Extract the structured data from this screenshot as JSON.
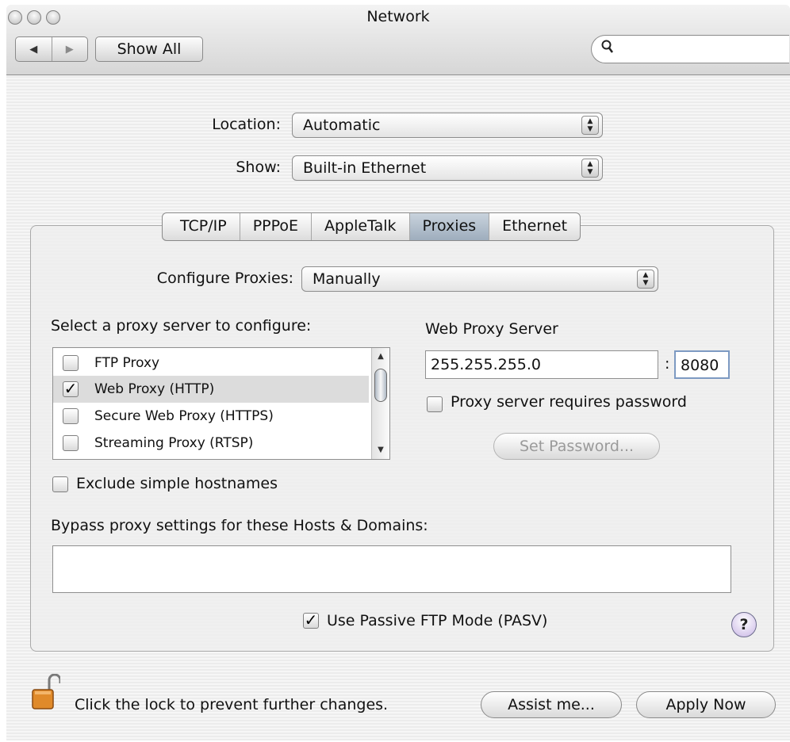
{
  "window": {
    "title": "Network"
  },
  "toolbar": {
    "back_glyph": "◀",
    "forward_glyph": "▶",
    "show_all_label": "Show All",
    "search_icon": "🔍"
  },
  "location": {
    "label": "Location:",
    "value": "Automatic"
  },
  "show": {
    "label": "Show:",
    "value": "Built-in Ethernet"
  },
  "tabs": [
    {
      "label": "TCP/IP"
    },
    {
      "label": "PPPoE"
    },
    {
      "label": "AppleTalk"
    },
    {
      "label": "Proxies",
      "active": true
    },
    {
      "label": "Ethernet"
    }
  ],
  "configure": {
    "label": "Configure Proxies:",
    "value": "Manually"
  },
  "proxy_list": {
    "heading": "Select a proxy server to configure:",
    "items": [
      {
        "label": "FTP Proxy",
        "checked": false,
        "check": ""
      },
      {
        "label": "Web Proxy (HTTP)",
        "checked": true,
        "check": "✓"
      },
      {
        "label": "Secure Web Proxy (HTTPS)",
        "checked": false,
        "check": ""
      },
      {
        "label": "Streaming Proxy (RTSP)",
        "checked": false,
        "check": ""
      }
    ]
  },
  "web_proxy": {
    "heading": "Web Proxy Server",
    "address": "255.255.255.0",
    "separator": ":",
    "port": "8080",
    "requires_password_label": "Proxy server requires password",
    "set_password_label": "Set Password..."
  },
  "exclude_simple_hostnames": {
    "label": "Exclude simple hostnames"
  },
  "bypass": {
    "label": "Bypass proxy settings for these Hosts & Domains:",
    "value": ""
  },
  "passive_ftp": {
    "label": "Use Passive FTP Mode (PASV)",
    "check": "✓"
  },
  "help": {
    "label": "?"
  },
  "footer": {
    "lock_text": "Click the lock to prevent further changes.",
    "assist_label": "Assist me...",
    "apply_label": "Apply Now"
  },
  "colors": {
    "active_tab": "#a8b6c6",
    "help_button": "#c9b6e6",
    "lock": "#e08a2a"
  }
}
